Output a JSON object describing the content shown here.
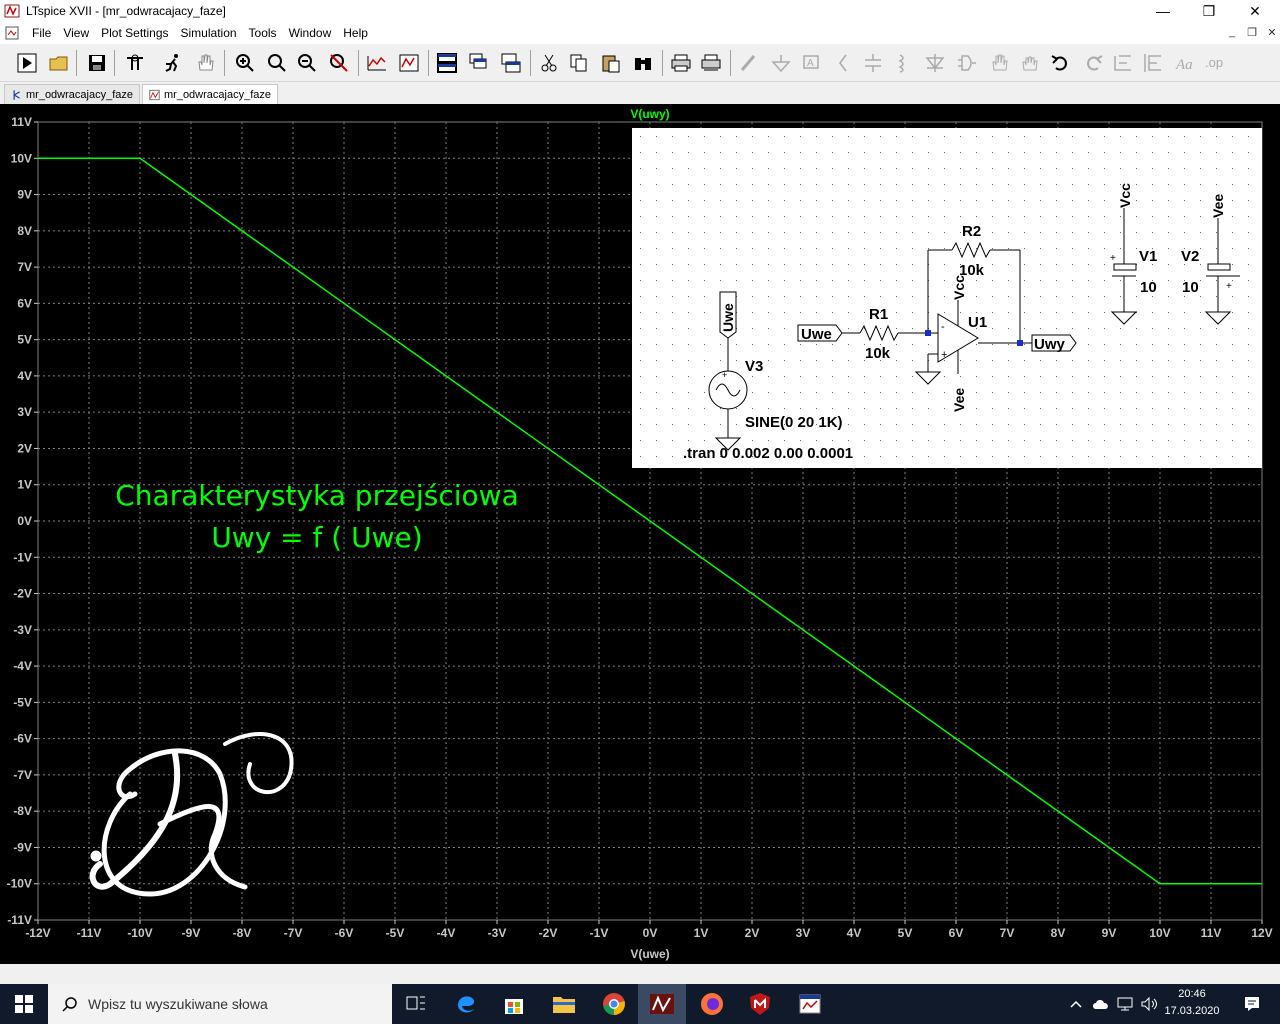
{
  "window": {
    "title": "LTspice XVII - [mr_odwracajacy_faze]"
  },
  "menu": [
    "File",
    "View",
    "Plot Settings",
    "Simulation",
    "Tools",
    "Window",
    "Help"
  ],
  "tabs": [
    {
      "label": "mr_odwracajacy_faze",
      "icon": "schematic-icon"
    },
    {
      "label": "mr_odwracajacy_faze",
      "icon": "waveform-icon"
    }
  ],
  "plot": {
    "trace_title": "V(uwy)",
    "xlabel": "V(uwe)",
    "annotation_line1": "Charakterystyka przejściowa",
    "annotation_line2": "Uwy = f ( Uwe)",
    "trace_color": "#00ff00",
    "grid_color": "#808080",
    "background": "#000000"
  },
  "chart_data": {
    "type": "line",
    "title": "V(uwy)",
    "xlabel": "V(uwe)",
    "ylabel": "",
    "xlim": [
      -12,
      12
    ],
    "ylim": [
      -11,
      11
    ],
    "x_ticks": [
      "-12V",
      "-11V",
      "-10V",
      "-9V",
      "-8V",
      "-7V",
      "-6V",
      "-5V",
      "-4V",
      "-3V",
      "-2V",
      "-1V",
      "0V",
      "1V",
      "2V",
      "3V",
      "4V",
      "5V",
      "6V",
      "7V",
      "8V",
      "9V",
      "10V",
      "11V",
      "12V"
    ],
    "y_ticks": [
      "11V",
      "10V",
      "9V",
      "8V",
      "7V",
      "6V",
      "5V",
      "4V",
      "3V",
      "2V",
      "1V",
      "0V",
      "-1V",
      "-2V",
      "-3V",
      "-4V",
      "-5V",
      "-6V",
      "-7V",
      "-8V",
      "-9V",
      "-10V",
      "-11V"
    ],
    "grid": true,
    "series": [
      {
        "name": "V(uwy)",
        "x": [
          -12,
          -10,
          10,
          12
        ],
        "y": [
          10,
          10,
          -10,
          -10
        ]
      }
    ]
  },
  "schematic": {
    "r1_name": "R1",
    "r1_value": "10k",
    "r2_name": "R2",
    "r2_value": "10k",
    "u1_name": "U1",
    "v1_name": "V1",
    "v1_value": "10",
    "v2_name": "V2",
    "v2_value": "10",
    "v3_name": "V3",
    "v3_value": "SINE(0 20 1K)",
    "net_uwe": "Uwe",
    "net_uwy": "Uwy",
    "net_vcc": "Vcc",
    "net_vee": "Vee",
    "tran": ".tran 0 0.002 0.00 0.0001"
  },
  "taskbar": {
    "search_placeholder": "Wpisz tu wyszukiwane słowa",
    "time": "20:46",
    "date": "17.03.2020"
  }
}
